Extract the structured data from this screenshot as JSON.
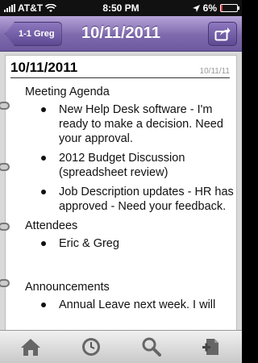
{
  "status_bar": {
    "carrier": "AT&T",
    "time": "8:50 PM",
    "battery_percent": "6%",
    "battery_level": 0.06
  },
  "nav": {
    "back_label": "1-1 Greg",
    "title": "10/11/2011"
  },
  "note": {
    "title": "10/11/2011",
    "date_small": "10/11/11",
    "sections": [
      {
        "heading": "Meeting Agenda",
        "items": [
          "New Help Desk software - I'm ready to make a decision. Need your approval.",
          "2012 Budget Discussion (spreadsheet review)",
          "Job Description updates - HR has approved - Need your feedback."
        ]
      },
      {
        "heading": "Attendees",
        "items": [
          "Eric & Greg"
        ]
      },
      {
        "heading": "Announcements",
        "items": [
          "Annual Leave next week.  I will"
        ]
      }
    ]
  },
  "tab_bar": {
    "items": [
      "home-icon",
      "clock-icon",
      "search-icon",
      "new-note-icon"
    ]
  },
  "colors": {
    "nav_purple": "#7e69ad",
    "battery_low": "#e33333"
  }
}
